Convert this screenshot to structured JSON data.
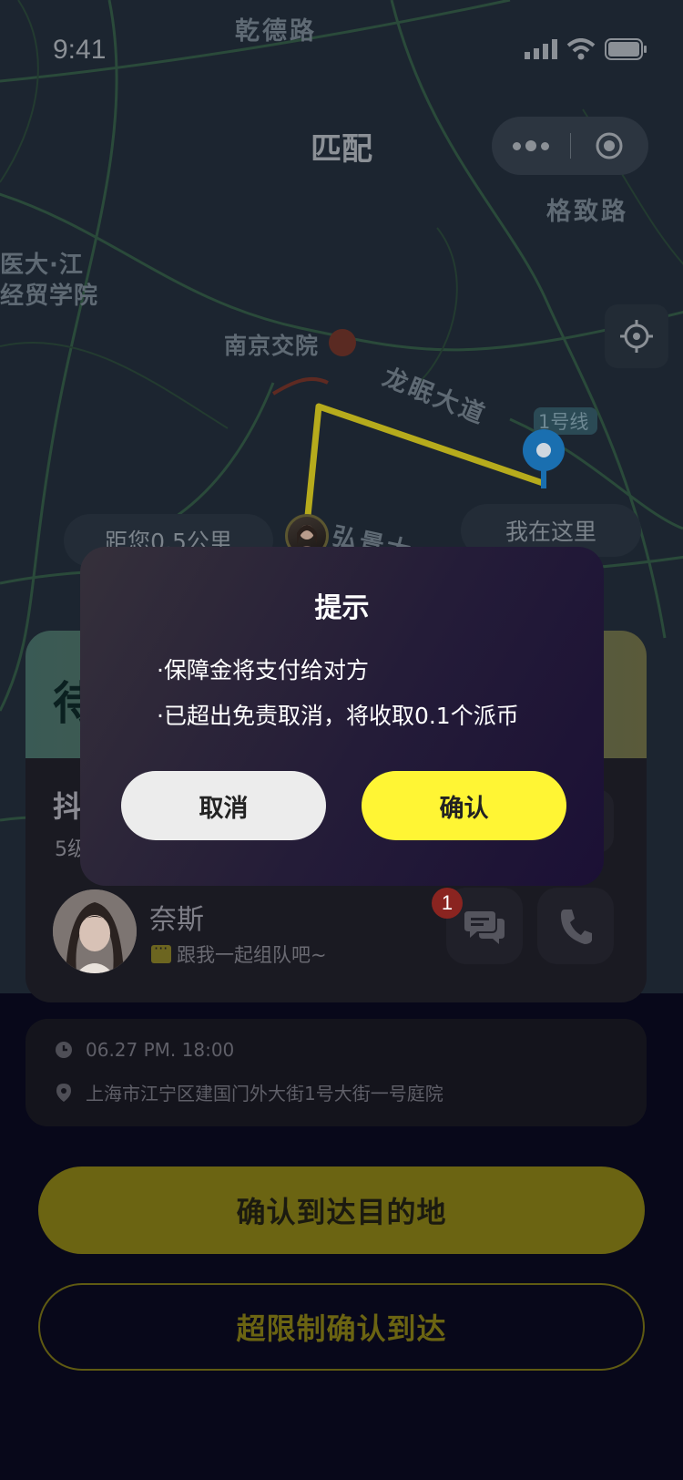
{
  "status_bar": {
    "time": "9:41"
  },
  "nav": {
    "title": "匹配"
  },
  "map": {
    "labels": {
      "road_top": "乾德路",
      "road_right": "格致路",
      "poi_left_1": "医大·江",
      "poi_left_2": "经贸学院",
      "poi_station": "南京交院",
      "road_longmian": "龙眠大道",
      "metro_line": "1号线",
      "road_hongjing": "弘景大"
    },
    "distance_bubble": "距您0.5公里",
    "my_location_bubble": "我在这里"
  },
  "card": {
    "banner_title": "待",
    "game_title": "抖",
    "level": "5级",
    "user": {
      "name": "奈斯",
      "message": "跟我一起组队吧~"
    },
    "unread_count": "1"
  },
  "info": {
    "time": "06.27  PM. 18:00",
    "address": "上海市江宁区建国门外大街1号大街一号庭院"
  },
  "actions": {
    "confirm_arrival": "确认到达目的地",
    "overlimit_confirm": "超限制确认到达"
  },
  "dialog": {
    "title": "提示",
    "lines": [
      "·保障金将支付给对方",
      "·已超出免责取消，将收取0.1个派币"
    ],
    "cancel_label": "取消",
    "confirm_label": "确认"
  },
  "colors": {
    "accent_yellow": "#fff534",
    "route": "#b6ab1c",
    "pin_blue": "#1a6fb0"
  }
}
